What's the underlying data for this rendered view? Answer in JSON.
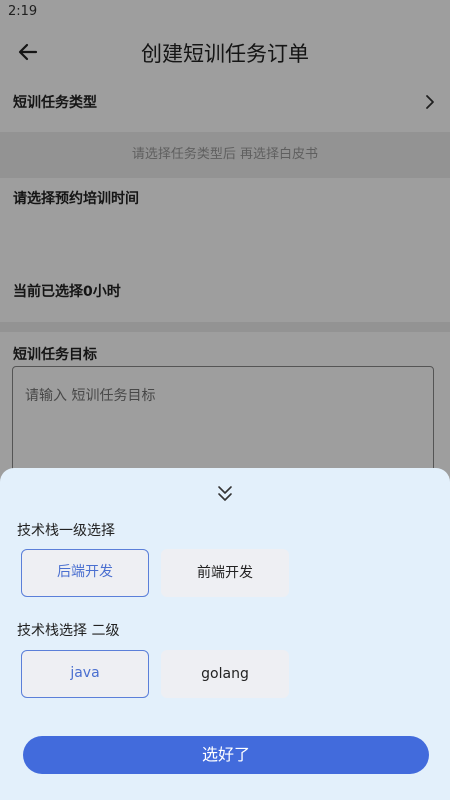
{
  "status": {
    "time": "2:19"
  },
  "header": {
    "title": "创建短训任务订单",
    "back_icon": "arrow-left-icon"
  },
  "form": {
    "type_label": "短训任务类型",
    "type_hint": "请选择任务类型后 再选择白皮书",
    "time_label": "请选择预约培训时间",
    "hours_label": "当前已选择0小时",
    "target_label": "短训任务目标",
    "target_placeholder": "请输入 短训任务目标"
  },
  "sheet": {
    "level1_title": "技术栈一级选择",
    "level1_options": [
      {
        "label": "后端开发",
        "selected": true
      },
      {
        "label": "前端开发",
        "selected": false
      }
    ],
    "level2_title": "技术栈选择 二级",
    "level2_options": [
      {
        "label": "java",
        "selected": true
      },
      {
        "label": "golang",
        "selected": false
      }
    ],
    "confirm_label": "选好了",
    "accent_color": "#426bdc"
  }
}
